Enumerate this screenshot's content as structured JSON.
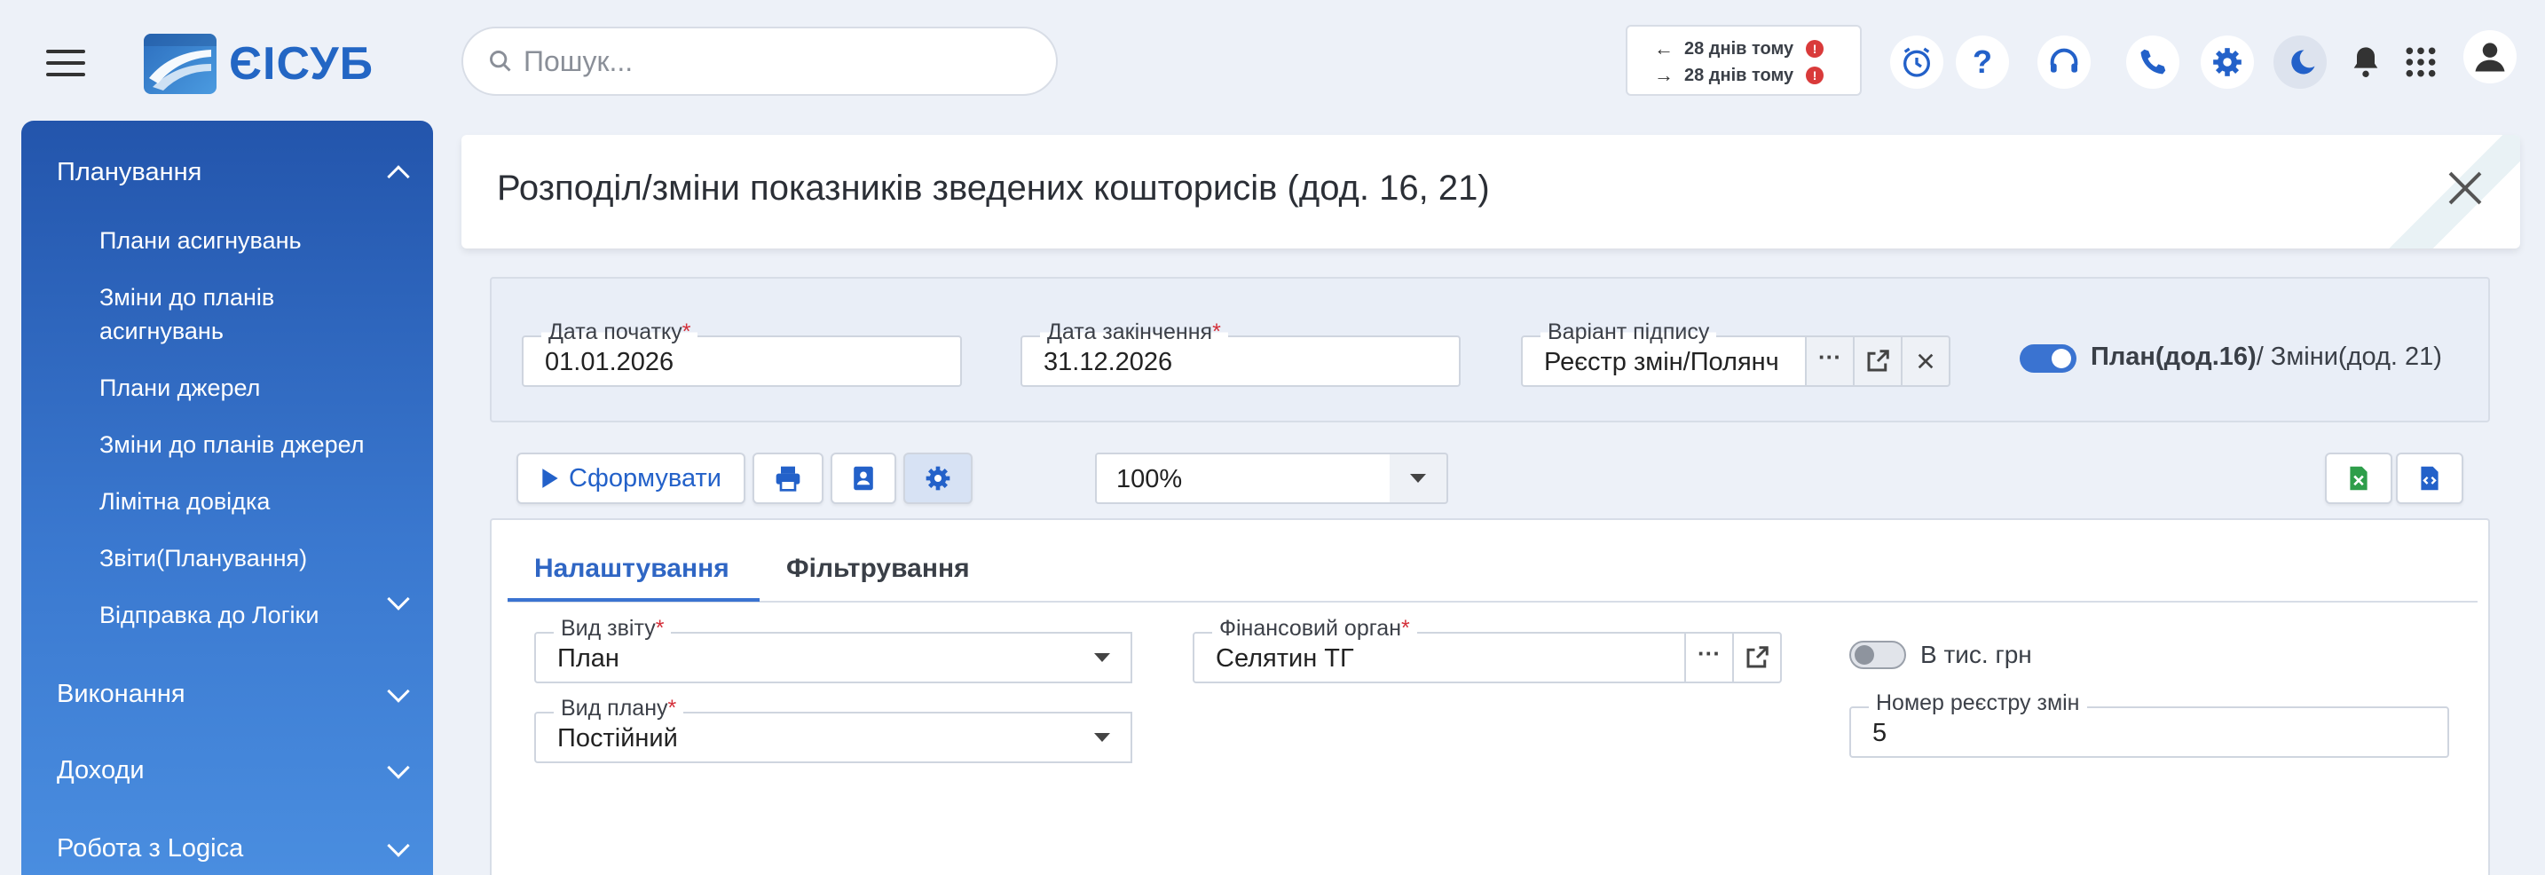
{
  "app": {
    "logo_text": "ЄІСУБ"
  },
  "search": {
    "placeholder": "Пошук..."
  },
  "sync": {
    "rows": [
      {
        "arrow": "←",
        "text": "28 днів тому"
      },
      {
        "arrow": "→",
        "text": "28 днів тому"
      }
    ],
    "badge": "!"
  },
  "topbar_icons": [
    "alarm-clock-icon",
    "help-icon",
    "headset-icon",
    "phone-icon",
    "gear-icon",
    "moon-icon",
    "bell-icon",
    "apps-grid-icon",
    "user-icon"
  ],
  "sidebar": {
    "groups": [
      {
        "label": "Планування",
        "expanded": true
      },
      {
        "label": "Виконання",
        "expanded": false
      },
      {
        "label": "Доходи",
        "expanded": false
      },
      {
        "label": "Робота з Logica",
        "expanded": false
      }
    ],
    "items": [
      {
        "label": "Плани асигнувань"
      },
      {
        "label": "Зміни до планів асигнувань"
      },
      {
        "label": "Плани джерел"
      },
      {
        "label": "Зміни до планів джерел"
      },
      {
        "label": "Лімітна довідка"
      },
      {
        "label": "Звіти(Планування)"
      },
      {
        "label": "Відправка до Логіки"
      }
    ]
  },
  "page": {
    "title": "Розподіл/зміни показників зведених кошторисів (дод. 16, 21)"
  },
  "params": {
    "date_start": {
      "label": "Дата початку",
      "value": "01.01.2026"
    },
    "date_end": {
      "label": "Дата закінчення",
      "value": "31.12.2026"
    },
    "signature": {
      "label": "Варіант підпису",
      "value": "Реєстр змін/Полянч"
    },
    "switch_left": "План(дод.16)",
    "switch_right": "/ Зміни(дод. 21)",
    "required_mark": "*"
  },
  "toolbar": {
    "generate_label": "Сформувати",
    "zoom": "100%"
  },
  "tabs": [
    {
      "label": "Налаштування",
      "active": true
    },
    {
      "label": "Фільтрування",
      "active": false
    }
  ],
  "form": {
    "report_type": {
      "label": "Вид звіту",
      "value": "План"
    },
    "plan_type": {
      "label": "Вид плану",
      "value": "Постійний"
    },
    "fin_org": {
      "label": "Фінансовий орган",
      "value": "Селятин ТГ"
    },
    "thousands": {
      "label": "В тис. грн"
    },
    "registry_no": {
      "label": "Номер реєстру змін",
      "value": "5"
    }
  },
  "colors": {
    "accent": "#3a73d1",
    "sidebar_top": "#2355ac",
    "required": "#d4303a",
    "excel": "#2e9e4a"
  }
}
